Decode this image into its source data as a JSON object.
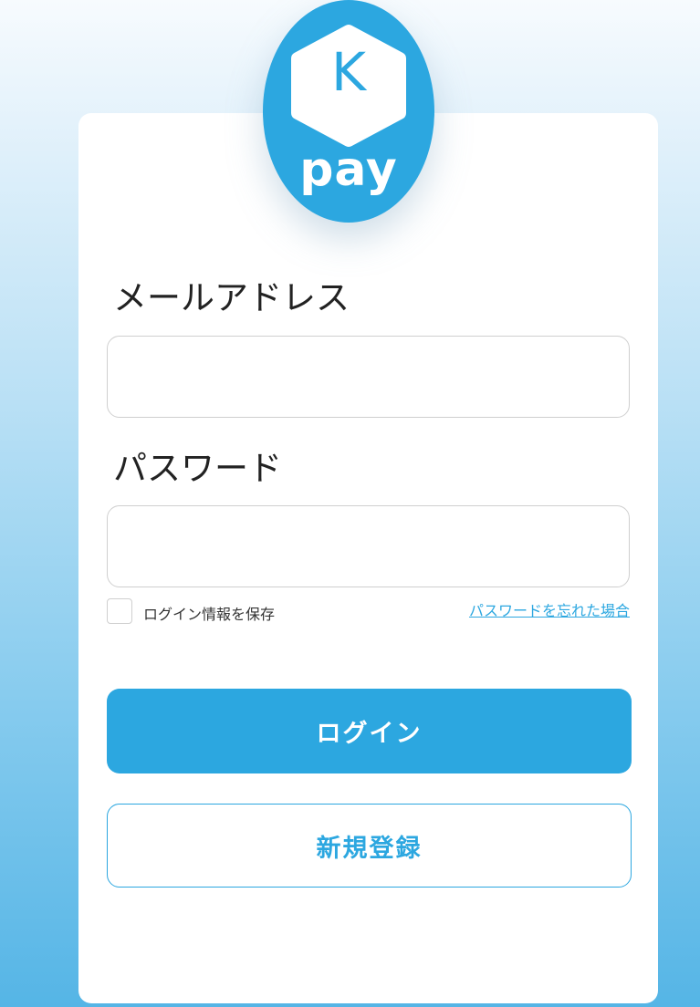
{
  "logo": {
    "letter": "K",
    "word": "pay",
    "icon": "kpay-logo-icon",
    "color": "#2ca7e0"
  },
  "form": {
    "email_label": "メールアドレス",
    "email_value": "",
    "password_label": "パスワード",
    "password_value": "",
    "remember_label": "ログイン情報を保存",
    "remember_checked": false,
    "forgot_link": "パスワードを忘れた場合"
  },
  "buttons": {
    "login_label": "ログイン",
    "register_label": "新規登録"
  },
  "colors": {
    "accent": "#2ca7e0",
    "background_top": "#f7fbfe",
    "background_bottom": "#55b5e6"
  }
}
